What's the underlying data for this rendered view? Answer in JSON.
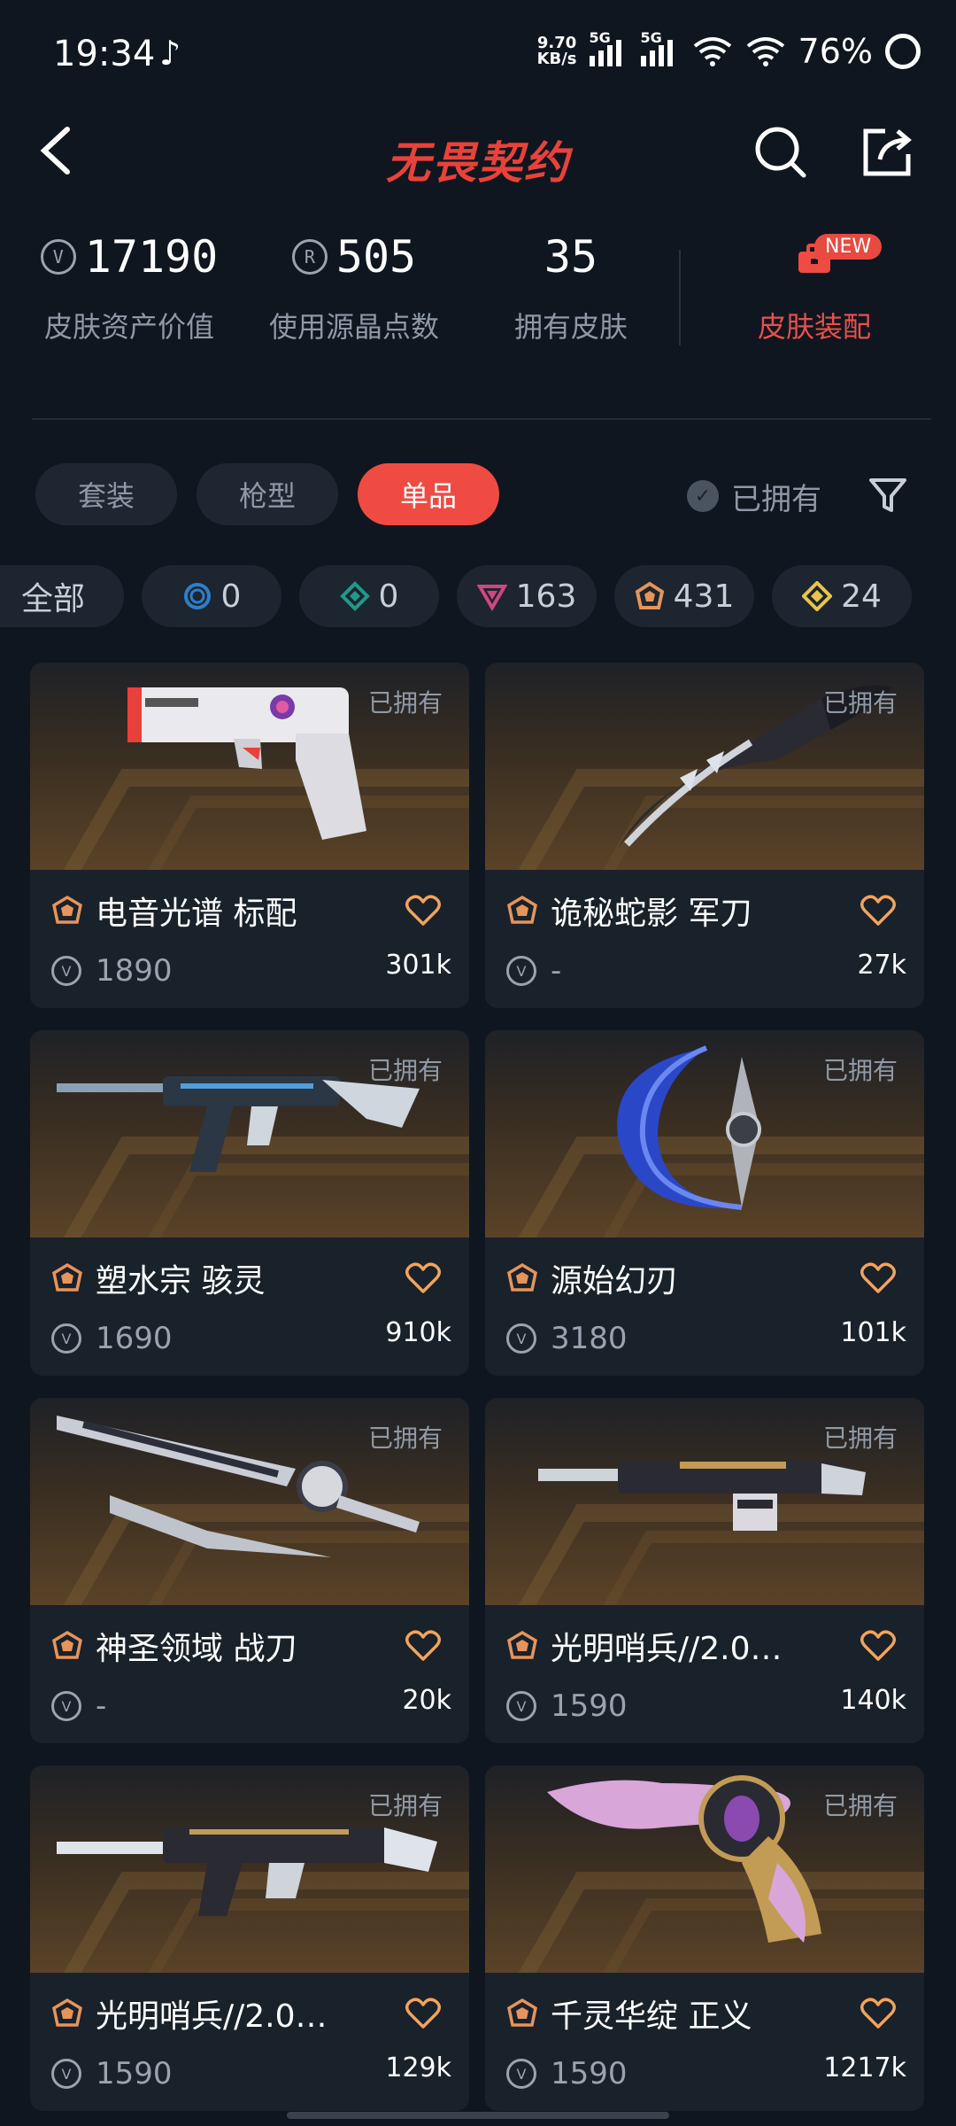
{
  "status_bar": {
    "time": "19:34",
    "net_speed_value": "9.70",
    "net_speed_unit": "KB/s",
    "sig1_label": "5G",
    "sig2_label": "5G",
    "battery": "76%"
  },
  "header": {
    "title": "无畏契约"
  },
  "stats": {
    "asset_value": "17190",
    "asset_label": "皮肤资产价值",
    "radianite_value": "505",
    "radianite_label": "使用源晶点数",
    "skins_owned": "35",
    "skins_owned_label": "拥有皮肤",
    "equip_label": "皮肤装配",
    "new_badge": "NEW"
  },
  "tabs": [
    {
      "label": "套装"
    },
    {
      "label": "枪型"
    },
    {
      "label": "单品",
      "active": true
    }
  ],
  "owned_filter": {
    "label": "已拥有"
  },
  "rarity_chips": [
    {
      "label": "全部",
      "icon": "all"
    },
    {
      "label": "0",
      "icon": "select-tier-icon",
      "color": "#2d7fc9"
    },
    {
      "label": "0",
      "icon": "deluxe-tier-icon",
      "color": "#1f9a8a"
    },
    {
      "label": "163",
      "icon": "premium-tier-icon",
      "color": "#d2467f"
    },
    {
      "label": "431",
      "icon": "exclusive-tier-icon",
      "color": "#e6945a"
    },
    {
      "label": "24",
      "icon": "ultra-tier-icon",
      "color": "#e8c54a"
    }
  ],
  "cards": [
    {
      "owned": "已拥有",
      "name": "电音光谱 标配",
      "price": "1890",
      "likes": "301k",
      "weapon": "pistol"
    },
    {
      "owned": "已拥有",
      "name": "诡秘蛇影 军刀",
      "price": "-",
      "likes": "27k",
      "weapon": "karambit"
    },
    {
      "owned": "已拥有",
      "name": "塑水宗 骇灵",
      "price": "1690",
      "likes": "910k",
      "weapon": "smg"
    },
    {
      "owned": "已拥有",
      "name": "源始幻刃",
      "price": "3180",
      "likes": "101k",
      "weapon": "crescent"
    },
    {
      "owned": "已拥有",
      "name": "神圣领域 战刀",
      "price": "-",
      "likes": "20k",
      "weapon": "sword"
    },
    {
      "owned": "已拥有",
      "name": "光明哨兵//2.0…",
      "price": "1590",
      "likes": "140k",
      "weapon": "shotgun"
    },
    {
      "owned": "已拥有",
      "name": "光明哨兵//2.0…",
      "price": "1590",
      "likes": "129k",
      "weapon": "rifle"
    },
    {
      "owned": "已拥有",
      "name": "千灵华绽 正义",
      "price": "1590",
      "likes": "1217k",
      "weapon": "revolver"
    }
  ]
}
